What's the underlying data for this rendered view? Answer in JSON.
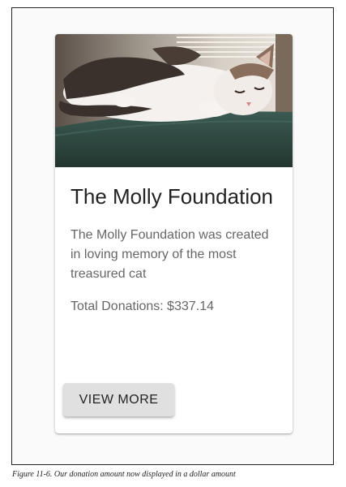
{
  "card": {
    "image_alt": "photo of a sleeping cat",
    "title": "The Molly Foundation",
    "description": "The Molly Foundation was created in loving memory of the most treasured cat",
    "donations": "Total Donations: $337.14",
    "button_label": "VIEW MORE"
  },
  "caption": "Figure 11-6. Our donation amount now displayed in a dollar amount",
  "colors": {
    "button_bg": "#e0e0e0",
    "title_text": "#222222",
    "body_text": "#666666"
  }
}
